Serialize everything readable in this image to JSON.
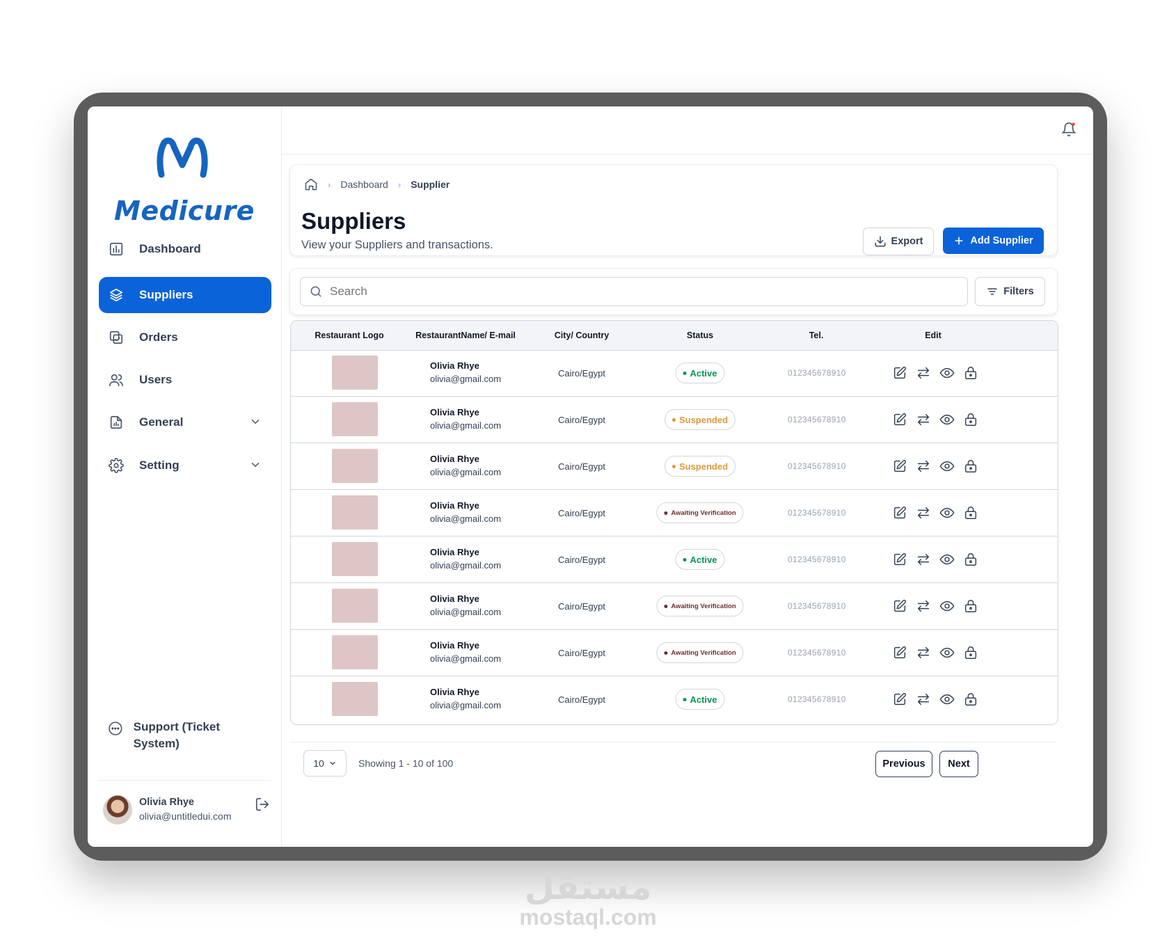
{
  "app": {
    "brand": "Medicure"
  },
  "sidebar": {
    "items": [
      {
        "label": "Dashboard",
        "icon": "bar-chart-icon",
        "active": false
      },
      {
        "label": "Suppliers",
        "icon": "layers-icon",
        "active": true
      },
      {
        "label": "Orders",
        "icon": "orders-icon",
        "active": false
      },
      {
        "label": "Users",
        "icon": "users-icon",
        "active": false
      },
      {
        "label": "General",
        "icon": "file-chart-icon",
        "active": false,
        "expandable": true
      },
      {
        "label": "Setting",
        "icon": "gear-icon",
        "active": false,
        "expandable": true
      }
    ],
    "support_label": "Support (Ticket System)",
    "user": {
      "name": "Olivia Rhye",
      "email": "olivia@untitledui.com"
    }
  },
  "breadcrumb": {
    "items": [
      "Dashboard",
      "Supplier"
    ]
  },
  "header": {
    "title": "Suppliers",
    "subtitle": "View your Suppliers and transactions.",
    "export_label": "Export",
    "add_label": "Add Supplier"
  },
  "search": {
    "placeholder": "Search",
    "filters_label": "Filters"
  },
  "table": {
    "columns": [
      "Restaurant Logo",
      "RestaurantName/ E-mail",
      "City/ Country",
      "Status",
      "Tel.",
      "Edit"
    ],
    "rows": [
      {
        "name": "Olivia Rhye",
        "email": "olivia@gmail.com",
        "city": "Cairo/Egypt",
        "status": "Active",
        "status_kind": "active",
        "tel": "012345678910"
      },
      {
        "name": "Olivia Rhye",
        "email": "olivia@gmail.com",
        "city": "Cairo/Egypt",
        "status": "Suspended",
        "status_kind": "suspended",
        "tel": "012345678910"
      },
      {
        "name": "Olivia Rhye",
        "email": "olivia@gmail.com",
        "city": "Cairo/Egypt",
        "status": "Suspended",
        "status_kind": "suspended",
        "tel": "012345678910"
      },
      {
        "name": "Olivia Rhye",
        "email": "olivia@gmail.com",
        "city": "Cairo/Egypt",
        "status": "Awaiting Verification",
        "status_kind": "awaiting",
        "tel": "012345678910"
      },
      {
        "name": "Olivia Rhye",
        "email": "olivia@gmail.com",
        "city": "Cairo/Egypt",
        "status": "Active",
        "status_kind": "active",
        "tel": "012345678910"
      },
      {
        "name": "Olivia Rhye",
        "email": "olivia@gmail.com",
        "city": "Cairo/Egypt",
        "status": "Awaiting Verification",
        "status_kind": "awaiting",
        "tel": "012345678910"
      },
      {
        "name": "Olivia Rhye",
        "email": "olivia@gmail.com",
        "city": "Cairo/Egypt",
        "status": "Awaiting Verification",
        "status_kind": "awaiting",
        "tel": "012345678910"
      },
      {
        "name": "Olivia Rhye",
        "email": "olivia@gmail.com",
        "city": "Cairo/Egypt",
        "status": "Active",
        "status_kind": "active",
        "tel": "012345678910"
      }
    ],
    "action_icons": [
      "edit-icon",
      "transfer-icon",
      "view-icon",
      "lock-icon"
    ]
  },
  "pagination": {
    "page_size": "10",
    "showing": "Showing 1 - 10 of 100",
    "prev_label": "Previous",
    "next_label": "Next"
  },
  "watermark": {
    "arabic": "مستقل",
    "text": "mostaql.com"
  },
  "colors": {
    "primary": "#0b63d9",
    "active": "#079455",
    "suspended": "#dc9a38",
    "awaiting": "#6e2f2f",
    "logo_placeholder": "#dfc6c6",
    "frame": "#5c5c5c"
  }
}
